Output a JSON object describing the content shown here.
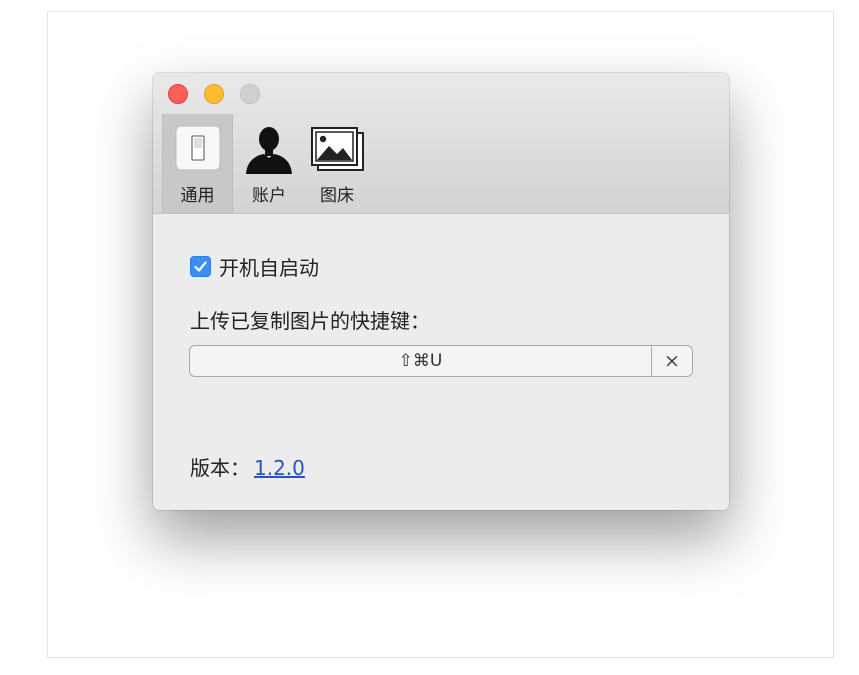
{
  "window": {
    "controls": {
      "close": "close-button",
      "minimize": "minimize-button",
      "maximize": "maximize-button"
    },
    "colors": {
      "close": "#fc5f57",
      "minimize": "#fdbc2e",
      "maximize_disabled": "#d0d0d0"
    }
  },
  "toolbar": {
    "tabs": [
      {
        "label": "通用",
        "icon": "switch-icon",
        "selected": true
      },
      {
        "label": "账户",
        "icon": "person-icon",
        "selected": false
      },
      {
        "label": "图床",
        "icon": "photos-icon",
        "selected": false
      }
    ]
  },
  "general": {
    "launch_at_login": {
      "label": "开机自启动",
      "checked": true,
      "color": "#3b8df5"
    },
    "shortcut": {
      "label": "上传已复制图片的快捷键：",
      "value": "⇧⌘U",
      "clear_label": "×"
    },
    "version": {
      "label": "版本：",
      "value": "1.2.0",
      "link_color": "#2a52c7"
    }
  }
}
